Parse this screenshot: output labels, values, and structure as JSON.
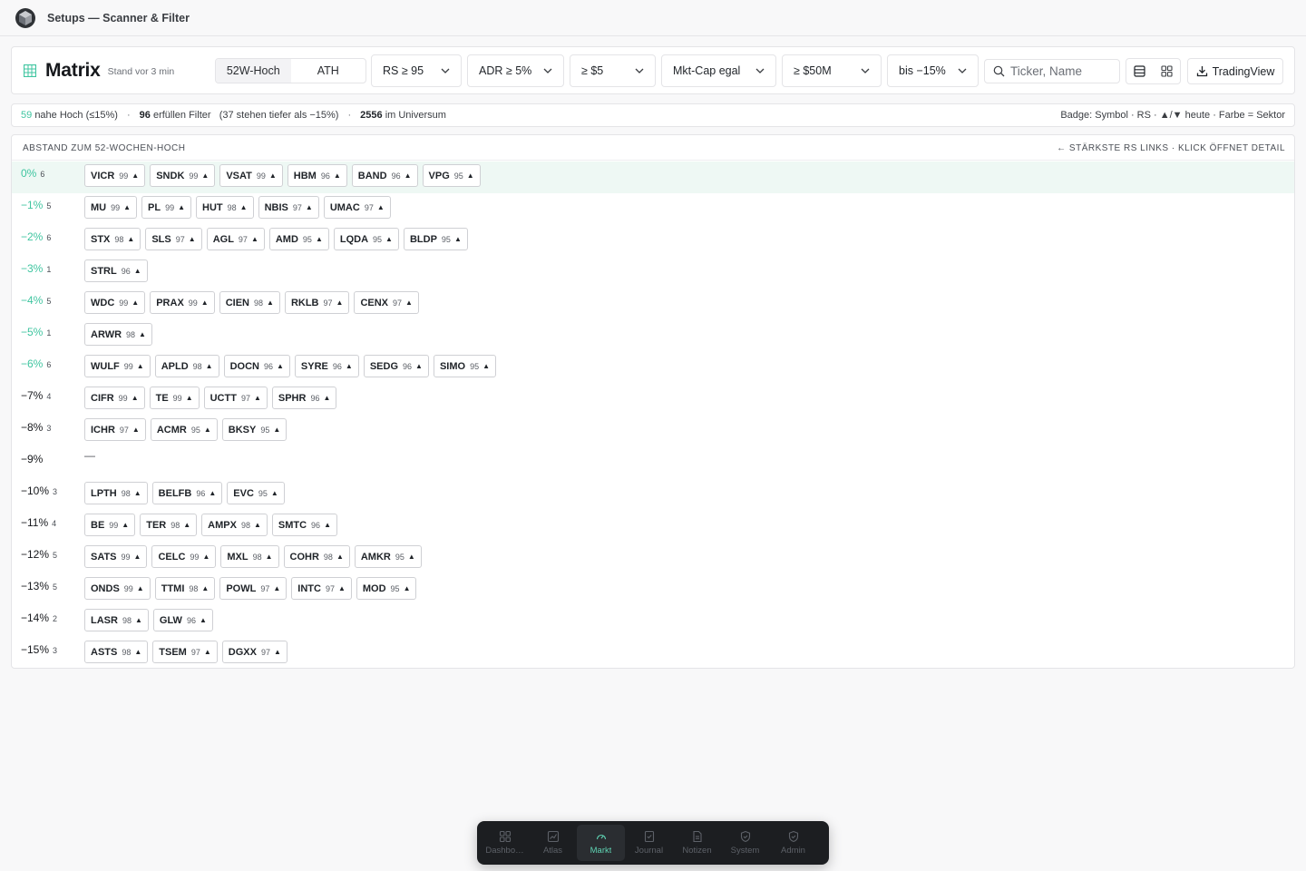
{
  "app": {
    "title": "Setups — Scanner & Filter"
  },
  "toolbar": {
    "title": "Matrix",
    "stand": "Stand vor 3 min",
    "segment": [
      "52W-Hoch",
      "ATH"
    ],
    "filters": [
      "RS ≥ 95",
      "ADR ≥ 5%",
      "≥ $5",
      "Mkt-Cap egal",
      "≥ $50M",
      "bis −15%"
    ],
    "search_placeholder": "Ticker, Name",
    "tv_label": "TradingView"
  },
  "info": {
    "near_count": "59",
    "near_text": "nahe Hoch (≤15%)",
    "filter_count": "96",
    "filter_text": "erfüllen Filter",
    "deeper": "(37 stehen tiefer als −15%)",
    "universe_count": "2556",
    "universe_text": "im Universum",
    "legend": "Badge: Symbol · RS · ▲/▼ heute · Farbe = Sektor"
  },
  "panel": {
    "header_left": "ABSTAND ZUM 52-WOCHEN-HOCH",
    "header_right": "← STÄRKSTE RS LINKS · KLICK ÖFFNET DETAIL",
    "empty_dash": "—",
    "rows": [
      {
        "label": "0%",
        "count": "6",
        "teal": true,
        "highlight": true,
        "chips": [
          [
            "VICR",
            "99"
          ],
          [
            "SNDK",
            "99"
          ],
          [
            "VSAT",
            "99"
          ],
          [
            "HBM",
            "96"
          ],
          [
            "BAND",
            "96"
          ],
          [
            "VPG",
            "95"
          ]
        ]
      },
      {
        "label": "−1%",
        "count": "5",
        "teal": true,
        "chips": [
          [
            "MU",
            "99"
          ],
          [
            "PL",
            "99"
          ],
          [
            "HUT",
            "98"
          ],
          [
            "NBIS",
            "97"
          ],
          [
            "UMAC",
            "97"
          ]
        ]
      },
      {
        "label": "−2%",
        "count": "6",
        "teal": true,
        "chips": [
          [
            "STX",
            "98"
          ],
          [
            "SLS",
            "97"
          ],
          [
            "AGL",
            "97"
          ],
          [
            "AMD",
            "95"
          ],
          [
            "LQDA",
            "95"
          ],
          [
            "BLDP",
            "95"
          ]
        ]
      },
      {
        "label": "−3%",
        "count": "1",
        "teal": true,
        "chips": [
          [
            "STRL",
            "96"
          ]
        ]
      },
      {
        "label": "−4%",
        "count": "5",
        "teal": true,
        "chips": [
          [
            "WDC",
            "99"
          ],
          [
            "PRAX",
            "99"
          ],
          [
            "CIEN",
            "98"
          ],
          [
            "RKLB",
            "97"
          ],
          [
            "CENX",
            "97"
          ]
        ]
      },
      {
        "label": "−5%",
        "count": "1",
        "teal": true,
        "chips": [
          [
            "ARWR",
            "98"
          ]
        ]
      },
      {
        "label": "−6%",
        "count": "6",
        "teal": true,
        "chips": [
          [
            "WULF",
            "99"
          ],
          [
            "APLD",
            "98"
          ],
          [
            "DOCN",
            "96"
          ],
          [
            "SYRE",
            "96"
          ],
          [
            "SEDG",
            "96"
          ],
          [
            "SIMO",
            "95"
          ]
        ]
      },
      {
        "label": "−7%",
        "count": "4",
        "teal": false,
        "chips": [
          [
            "CIFR",
            "99"
          ],
          [
            "TE",
            "99"
          ],
          [
            "UCTT",
            "97"
          ],
          [
            "SPHR",
            "96"
          ]
        ]
      },
      {
        "label": "−8%",
        "count": "3",
        "teal": false,
        "chips": [
          [
            "ICHR",
            "97"
          ],
          [
            "ACMR",
            "95"
          ],
          [
            "BKSY",
            "95"
          ]
        ]
      },
      {
        "label": "−9%",
        "count": "",
        "teal": false,
        "chips": []
      },
      {
        "label": "−10%",
        "count": "3",
        "teal": false,
        "chips": [
          [
            "LPTH",
            "98"
          ],
          [
            "BELFB",
            "96"
          ],
          [
            "EVC",
            "95"
          ]
        ]
      },
      {
        "label": "−11%",
        "count": "4",
        "teal": false,
        "chips": [
          [
            "BE",
            "99"
          ],
          [
            "TER",
            "98"
          ],
          [
            "AMPX",
            "98"
          ],
          [
            "SMTC",
            "96"
          ]
        ]
      },
      {
        "label": "−12%",
        "count": "5",
        "teal": false,
        "chips": [
          [
            "SATS",
            "99"
          ],
          [
            "CELC",
            "99"
          ],
          [
            "MXL",
            "98"
          ],
          [
            "COHR",
            "98"
          ],
          [
            "AMKR",
            "95"
          ]
        ]
      },
      {
        "label": "−13%",
        "count": "5",
        "teal": false,
        "chips": [
          [
            "ONDS",
            "99"
          ],
          [
            "TTMI",
            "98"
          ],
          [
            "POWL",
            "97"
          ],
          [
            "INTC",
            "97"
          ],
          [
            "MOD",
            "95"
          ]
        ]
      },
      {
        "label": "−14%",
        "count": "2",
        "teal": false,
        "chips": [
          [
            "LASR",
            "98"
          ],
          [
            "GLW",
            "96"
          ]
        ]
      },
      {
        "label": "−15%",
        "count": "3",
        "teal": false,
        "chips": [
          [
            "ASTS",
            "98"
          ],
          [
            "TSEM",
            "97"
          ],
          [
            "DGXX",
            "97"
          ]
        ]
      }
    ]
  },
  "dock": {
    "items": [
      {
        "label": "Dashbo…",
        "icon": "dashboard-icon"
      },
      {
        "label": "Atlas",
        "icon": "chart-icon"
      },
      {
        "label": "Markt",
        "icon": "gauge-icon"
      },
      {
        "label": "Journal",
        "icon": "journal-icon"
      },
      {
        "label": "Notizen",
        "icon": "note-icon"
      },
      {
        "label": "System",
        "icon": "shield-icon"
      },
      {
        "label": "Admin",
        "icon": "shield-check-icon"
      }
    ],
    "active_index": 2
  },
  "colors": {
    "accent": "#3fc5a0",
    "highlight_row": "#eef8f4",
    "dock_bg": "#1c1e21"
  }
}
